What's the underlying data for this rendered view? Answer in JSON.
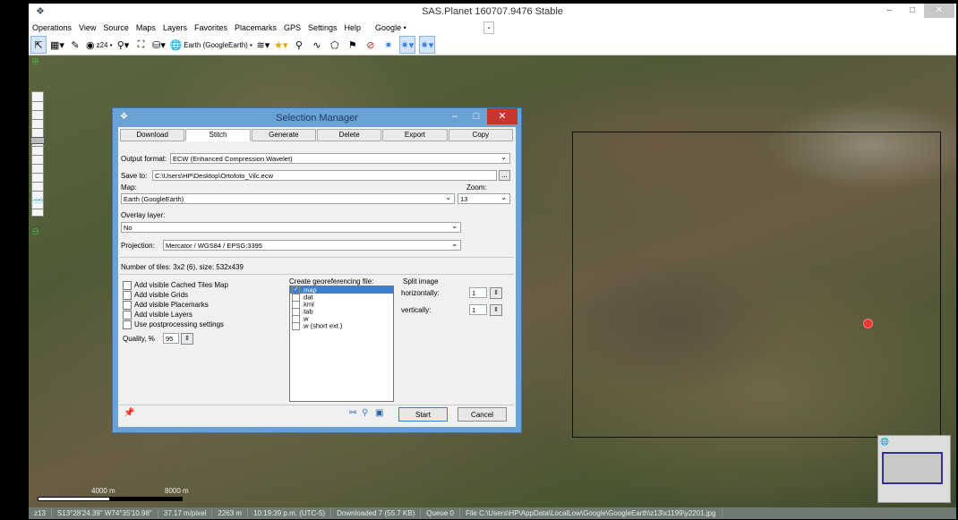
{
  "window": {
    "title": "SAS.Planet 160707.9476 Stable"
  },
  "menu": [
    "Operations",
    "View",
    "Source",
    "Maps",
    "Layers",
    "Favorites",
    "Placemarks",
    "GPS",
    "Settings",
    "Help",
    "Google •"
  ],
  "toolbar": {
    "zoom_label": "z24 •",
    "map_label": "Earth (GoogleEarth) •"
  },
  "left": {
    "zoom_level": "z13"
  },
  "scale": {
    "left": "4000 m",
    "right": "8000 m"
  },
  "status": [
    "z13",
    "S13°28'24.39\" W74°35'10.98\"",
    "37.17 m/pixel",
    "2263 m",
    "10:19:39 p.m. (UTC-5)",
    "Downloaded 7 (55.7 KB)",
    "Queue 0",
    "File C:\\Users\\HP\\AppData\\LocalLow\\Google\\GoogleEarth\\z13\\x1199\\y2201.jpg"
  ],
  "dialog": {
    "title": "Selection Manager",
    "tabs": [
      "Download",
      "Stitch",
      "Generate",
      "Delete",
      "Export",
      "Copy"
    ],
    "output_format_label": "Output format:",
    "output_format_value": "ECW (Enhanced Compression Wavelet)",
    "save_to_label": "Save to:",
    "save_to_value": "C:\\Users\\HP\\Desktop\\Ortofoto_Vilc.ecw",
    "browse_label": "...",
    "map_label": "Map:",
    "map_value": "Earth (GoogleEarth)",
    "zoom_label": "Zoom:",
    "zoom_value": "13",
    "overlay_label": "Overlay layer:",
    "overlay_value": "No",
    "projection_label": "Projection:",
    "projection_value": "Mercator / WGS84 / EPSG:3395",
    "tiles_info": "Number of tiles: 3x2 (6), size: 532x439",
    "checks": [
      "Add visible Cached Tiles Map",
      "Add visible Grids",
      "Add visible Placemarks",
      "Add visible Layers",
      "Use postprocessing settings"
    ],
    "quality_label": "Quality, %",
    "quality_value": "95",
    "georef_label": "Create georeferencing file:",
    "georef_items": [
      ".map",
      ".dat",
      ".kml",
      ".tab",
      ".w",
      ".w (short ext.)"
    ],
    "split_label": "Split image",
    "horiz_label": "horizontally:",
    "horiz_value": "1",
    "vert_label": "vertically:",
    "vert_value": "1",
    "start_label": "Start",
    "cancel_label": "Cancel"
  }
}
